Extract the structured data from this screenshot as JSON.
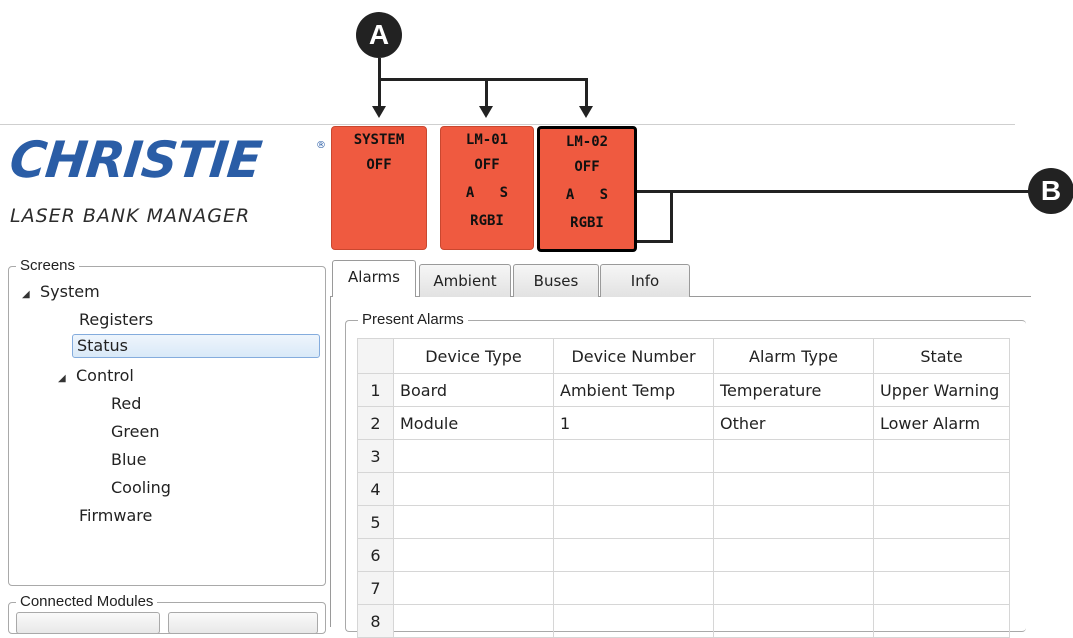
{
  "callouts": {
    "a": "A",
    "b": "B"
  },
  "logo": {
    "brand": "CHRISTIE",
    "registered": "®",
    "subtitle": "LASER BANK MANAGER"
  },
  "status_boxes": [
    {
      "lines": [
        "SYSTEM",
        "OFF"
      ]
    },
    {
      "lines": [
        "LM-01",
        "OFF",
        "A   S",
        "RGBI"
      ]
    },
    {
      "lines": [
        "LM-02",
        "OFF",
        "A   S",
        "RGBI"
      ],
      "selected": true
    }
  ],
  "colors": {
    "status_box": "#ef5a40",
    "logo": "#2a5da6",
    "selection": "#d9e9f8"
  },
  "screens_panel": {
    "title": "Screens",
    "tree": {
      "system": "System",
      "registers": "Registers",
      "status": "Status",
      "control": "Control",
      "red": "Red",
      "green": "Green",
      "blue": "Blue",
      "cooling": "Cooling",
      "firmware": "Firmware"
    },
    "selected": "Status"
  },
  "connected_modules_panel": {
    "title": "Connected Modules"
  },
  "tabs": [
    {
      "label": "Alarms",
      "active": true
    },
    {
      "label": "Ambient"
    },
    {
      "label": "Buses"
    },
    {
      "label": "Info"
    }
  ],
  "present_alarms": {
    "title": "Present Alarms",
    "columns": [
      "Device Type",
      "Device Number",
      "Alarm Type",
      "State"
    ],
    "rows": [
      {
        "n": "1",
        "cells": [
          "Board",
          "Ambient Temp",
          "Temperature",
          "Upper Warning"
        ]
      },
      {
        "n": "2",
        "cells": [
          "Module",
          "1",
          "Other",
          "Lower Alarm"
        ]
      },
      {
        "n": "3",
        "cells": [
          "",
          "",
          "",
          ""
        ]
      },
      {
        "n": "4",
        "cells": [
          "",
          "",
          "",
          ""
        ]
      },
      {
        "n": "5",
        "cells": [
          "",
          "",
          "",
          ""
        ]
      },
      {
        "n": "6",
        "cells": [
          "",
          "",
          "",
          ""
        ]
      },
      {
        "n": "7",
        "cells": [
          "",
          "",
          "",
          ""
        ]
      },
      {
        "n": "8",
        "cells": [
          "",
          "",
          "",
          ""
        ]
      }
    ]
  }
}
